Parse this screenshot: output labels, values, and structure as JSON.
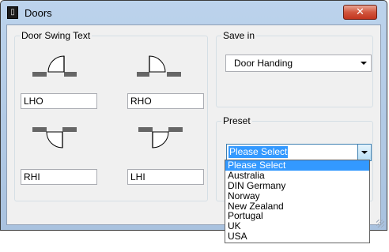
{
  "window": {
    "title": "Doors",
    "close_label": "✕"
  },
  "door_swing": {
    "legend": "Door Swing Text",
    "fields": [
      {
        "value": "LHO"
      },
      {
        "value": "RHO"
      },
      {
        "value": "RHI"
      },
      {
        "value": "LHI"
      }
    ]
  },
  "save_in": {
    "legend": "Save in",
    "selected": "Door Handing"
  },
  "preset": {
    "legend": "Preset",
    "selected": "Please Select",
    "options": [
      "Please Select",
      "Australia",
      "DIN Germany",
      "Norway",
      "New Zealand",
      "Portugal",
      "UK",
      "USA"
    ]
  },
  "icons": {
    "app": "door-app-icon",
    "close": "close-icon",
    "dropdown": "chevron-down-icon",
    "door_lho": "door-lho-icon",
    "door_rho": "door-rho-icon",
    "door_rhi": "door-rhi-icon",
    "door_lhi": "door-lhi-icon"
  },
  "colors": {
    "selection": "#3399ff",
    "close_button": "#c2351e",
    "title_bar": "#bcd3ec"
  }
}
